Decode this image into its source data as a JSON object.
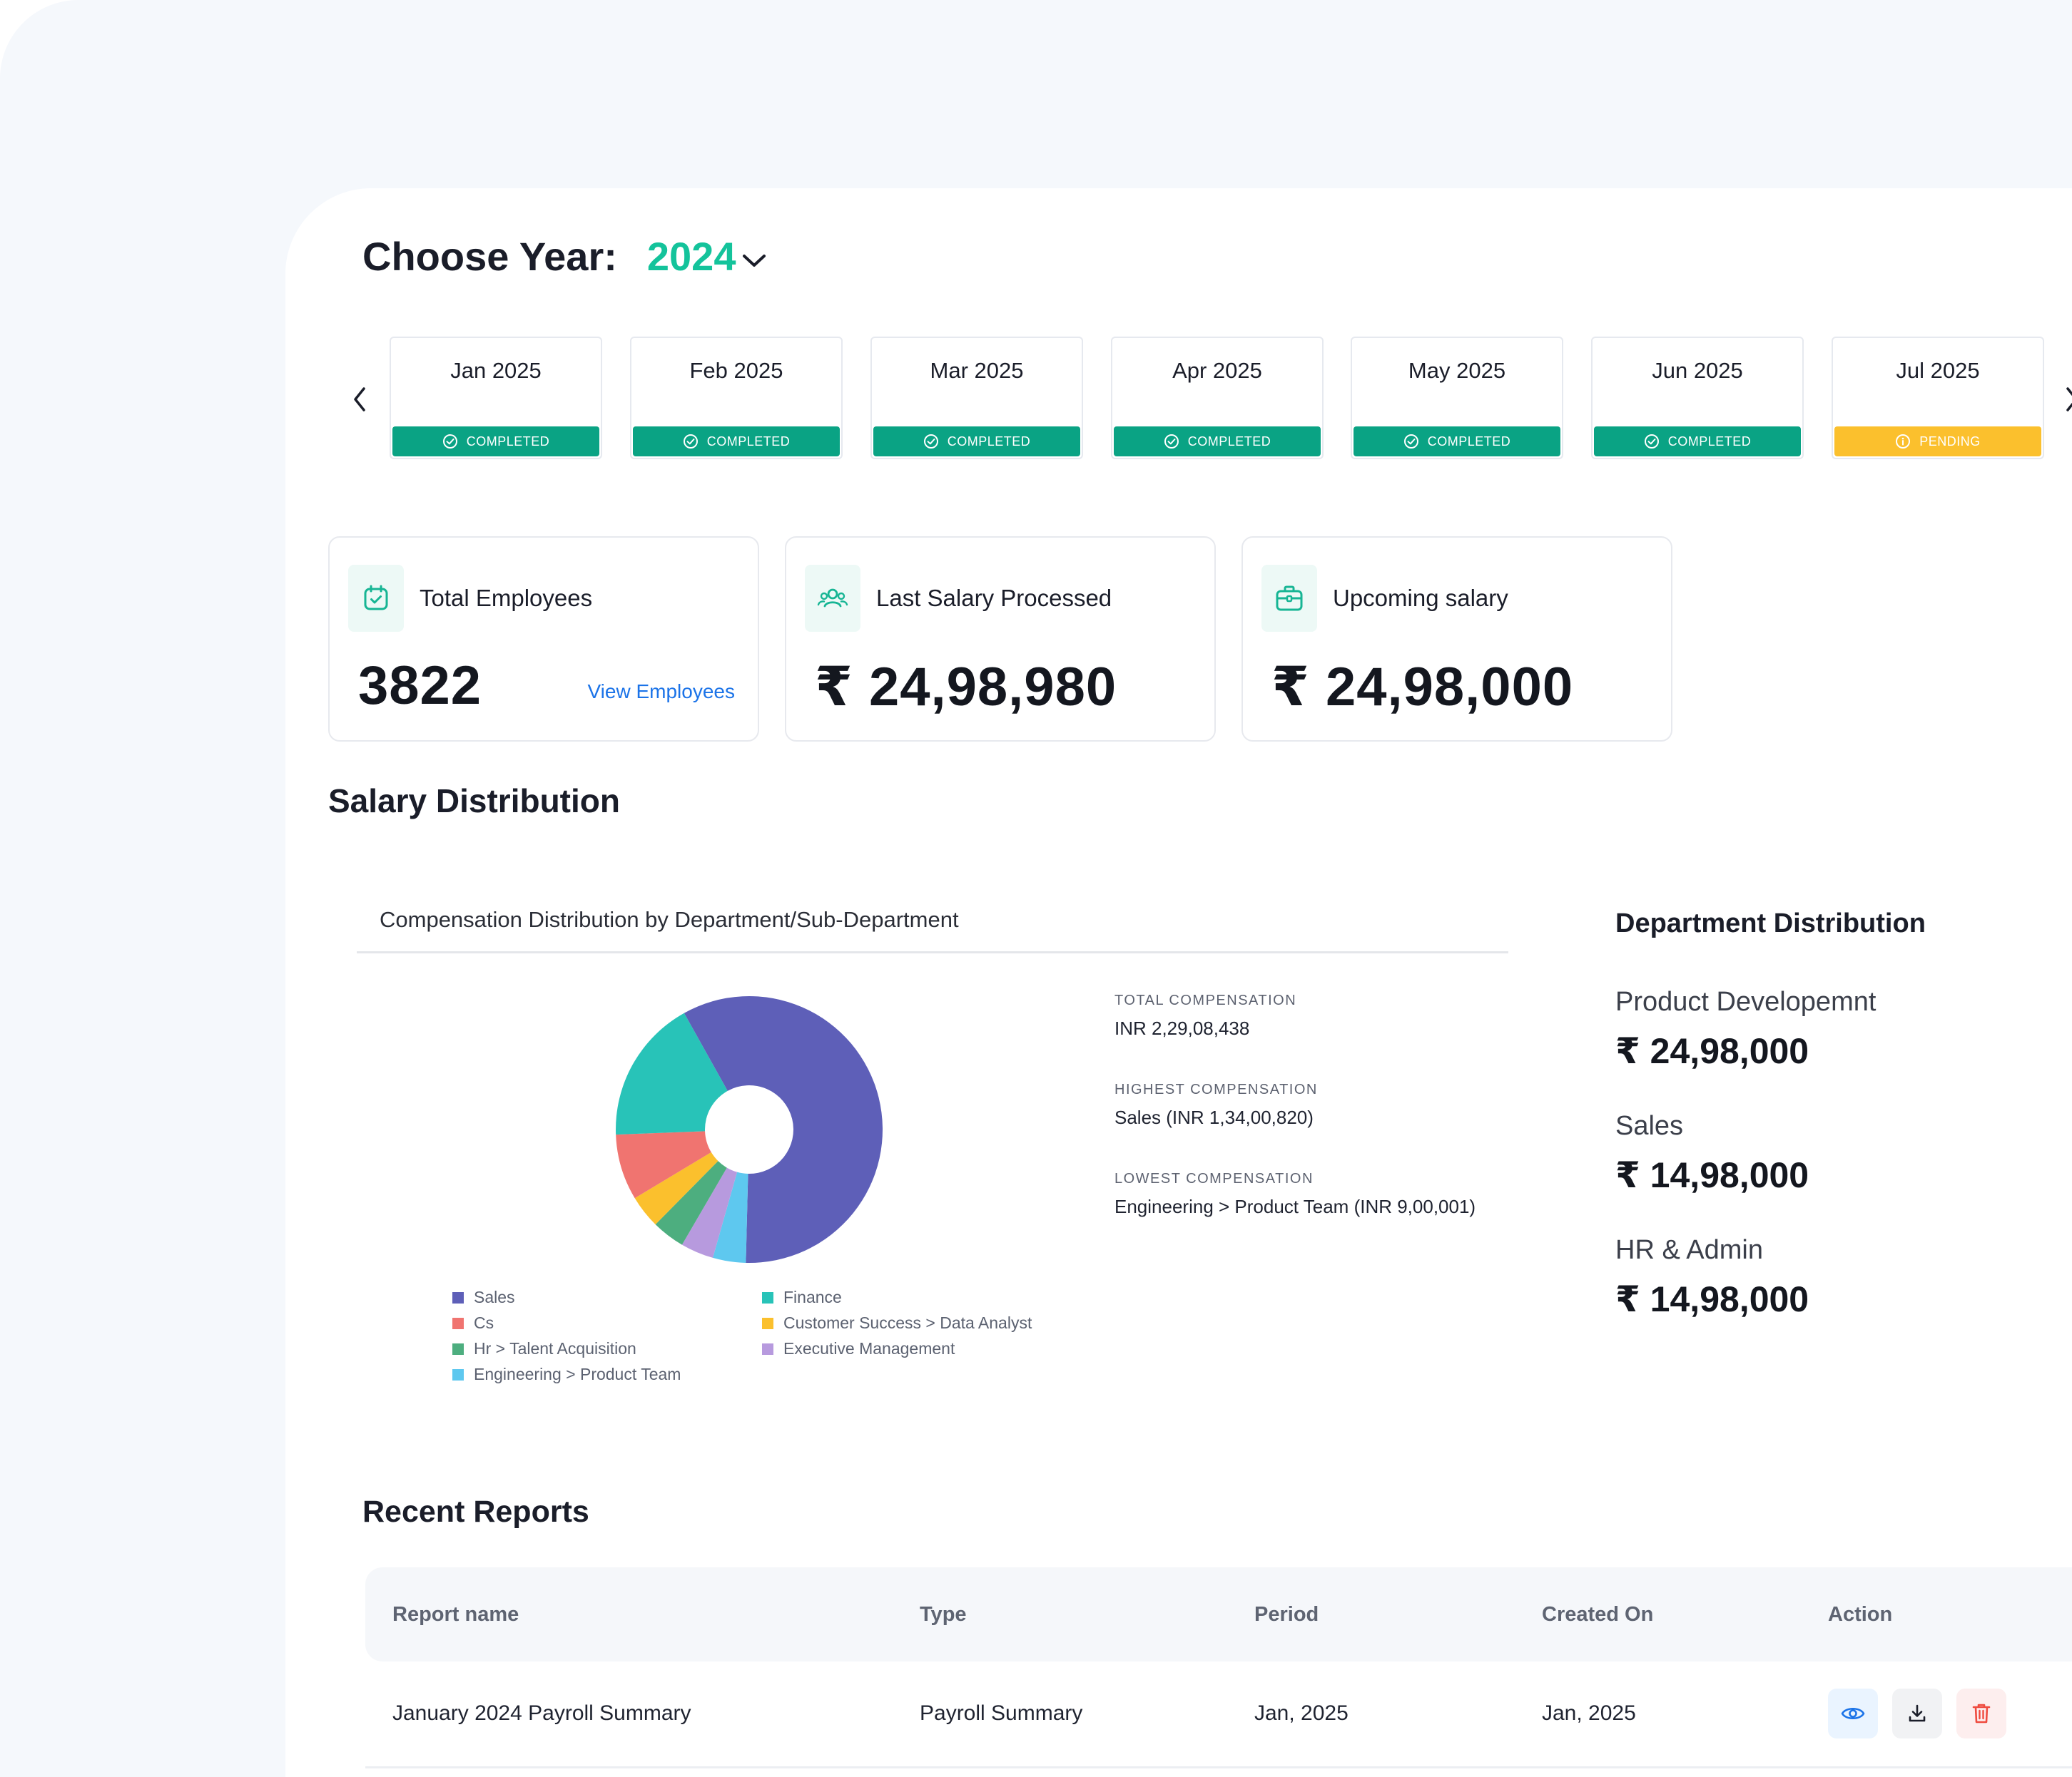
{
  "year": {
    "label": "Choose Year:",
    "value": "2024"
  },
  "months": [
    {
      "name": "Jan 2025",
      "status": "COMPLETED",
      "state": "completed"
    },
    {
      "name": "Feb 2025",
      "status": "COMPLETED",
      "state": "completed"
    },
    {
      "name": "Mar 2025",
      "status": "COMPLETED",
      "state": "completed"
    },
    {
      "name": "Apr 2025",
      "status": "COMPLETED",
      "state": "completed"
    },
    {
      "name": "May 2025",
      "status": "COMPLETED",
      "state": "completed"
    },
    {
      "name": "Jun 2025",
      "status": "COMPLETED",
      "state": "completed"
    },
    {
      "name": "Jul 2025",
      "status": "PENDING",
      "state": "pending"
    }
  ],
  "stats": {
    "employees": {
      "title": "Total Employees",
      "value": "3822",
      "link": "View Employees",
      "icon": "calendar-check-icon"
    },
    "last_salary": {
      "title": "Last Salary Processed",
      "value": "₹ 24,98,980",
      "icon": "users-group-icon"
    },
    "upcoming": {
      "title": "Upcoming salary",
      "value": "₹ 24,98,000",
      "icon": "briefcase-icon"
    }
  },
  "salary_distribution": {
    "title": "Salary Distribution",
    "chart_title": "Compensation Distribution by Department/Sub-Department",
    "summary": [
      {
        "label": "TOTAL COMPENSATION",
        "value": "INR 2,29,08,438"
      },
      {
        "label": "HIGHEST COMPENSATION",
        "value": "Sales (INR 1,34,00,820)"
      },
      {
        "label": "LOWEST COMPENSATION",
        "value": "Engineering > Product Team (INR 9,00,001)"
      }
    ]
  },
  "chart_data": {
    "type": "pie",
    "title": "Compensation Distribution by Department/Sub-Department",
    "series": [
      {
        "name": "Sales",
        "value": 58.5,
        "color": "#5e5fb8"
      },
      {
        "name": "Engineering > Product Team",
        "value": 4.0,
        "color": "#5ec8ef"
      },
      {
        "name": "Executive Management",
        "value": 4.0,
        "color": "#b79ade"
      },
      {
        "name": "Hr > Talent Acquisition",
        "value": 4.0,
        "color": "#4dae7f"
      },
      {
        "name": "Customer Success > Data Analyst",
        "value": 4.0,
        "color": "#fbc02d"
      },
      {
        "name": "Cs",
        "value": 8.0,
        "color": "#f07470"
      },
      {
        "name": "Finance",
        "value": 17.5,
        "color": "#28c3b8"
      }
    ],
    "legend": [
      {
        "name": "Sales",
        "color": "#5e5fb8"
      },
      {
        "name": "Cs",
        "color": "#f07470"
      },
      {
        "name": "Hr > Talent Acquisition",
        "color": "#4dae7f"
      },
      {
        "name": "Engineering > Product Team",
        "color": "#5ec8ef"
      },
      {
        "name": "Finance",
        "color": "#28c3b8"
      },
      {
        "name": "Customer Success > Data Analyst",
        "color": "#fbc02d"
      },
      {
        "name": "Executive Management",
        "color": "#b79ade"
      }
    ]
  },
  "department": {
    "title": "Department Distribution",
    "items": [
      {
        "name": "Product Developemnt",
        "value": "₹ 24,98,000"
      },
      {
        "name": "Sales",
        "value": "₹ 14,98,000"
      },
      {
        "name": "HR & Admin",
        "value": "₹ 14,98,000"
      }
    ]
  },
  "reports": {
    "title": "Recent Reports",
    "columns": [
      "Report name",
      "Type",
      "Period",
      "Created On",
      "Action"
    ],
    "rows": [
      {
        "name": "January 2024 Payroll Summary",
        "type": "Payroll Summary",
        "period": "Jan, 2025",
        "created": "Jan, 2025"
      }
    ]
  }
}
